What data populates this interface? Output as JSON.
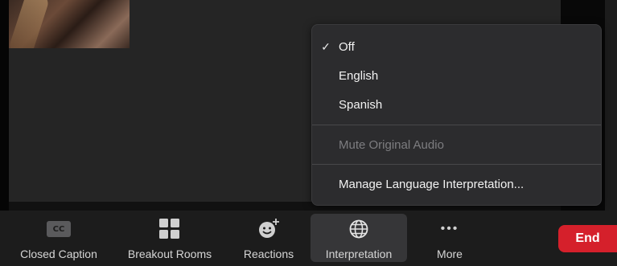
{
  "menu": {
    "items": [
      {
        "label": "Off",
        "checked": true,
        "check_glyph": "✓"
      },
      {
        "label": "English",
        "checked": false
      },
      {
        "label": "Spanish",
        "checked": false
      }
    ],
    "mute_label": "Mute Original Audio",
    "manage_label": "Manage Language Interpretation..."
  },
  "toolbar": {
    "closed_caption": {
      "label": "Closed Caption",
      "icon_text": "CC",
      "icon": "cc-icon"
    },
    "breakout_rooms": {
      "label": "Breakout Rooms",
      "icon": "grid-icon"
    },
    "reactions": {
      "label": "Reactions",
      "icon": "smiley-plus-icon"
    },
    "interpretation": {
      "label": "Interpretation",
      "icon": "globe-icon",
      "active": true
    },
    "more": {
      "label": "More",
      "icon_text": "•••",
      "icon": "ellipsis-icon"
    },
    "end": {
      "label": "End",
      "color": "#d5202b"
    }
  },
  "colors": {
    "menu_bg": "#2c2c2e",
    "toolbar_bg": "#1c1c1c",
    "end_red": "#d5202b"
  }
}
